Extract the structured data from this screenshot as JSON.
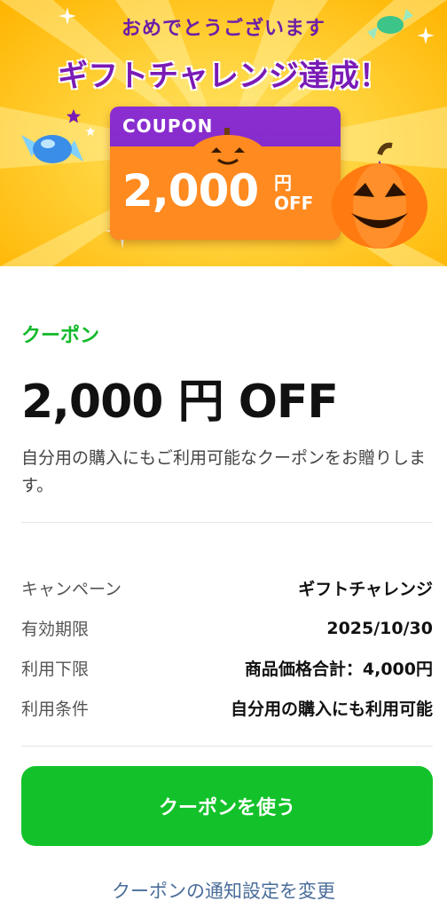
{
  "banner": {
    "subtitle": "おめでとうございます",
    "title": "ギフトチャレンジ達成！",
    "coupon_label": "COUPON",
    "coupon_amount": "2,000",
    "coupon_yen": "円",
    "coupon_off": "OFF",
    "icons": [
      "candy-icon",
      "pumpkin-icon",
      "star-icon",
      "sparkle-icon"
    ]
  },
  "coupon": {
    "kind_label": "クーポン",
    "amount": "2,000 円 OFF",
    "description": "自分用の購入にもご利用可能なクーポンをお贈りします。"
  },
  "details": [
    {
      "key": "キャンペーン",
      "value": "ギフトチャレンジ"
    },
    {
      "key": "有効期限",
      "value": "2025/10/30"
    },
    {
      "key": "利用下限",
      "value": "商品価格合計：4,000円"
    },
    {
      "key": "利用条件",
      "value": "自分用の購入にも利用可能"
    }
  ],
  "actions": {
    "use_button": "クーポンを使う",
    "notification_link": "クーポンの通知設定を変更"
  },
  "colors": {
    "accent_green": "#13c22a",
    "kind_green": "#12b92a",
    "banner_purple": "#7a1bb5",
    "link_blue": "#4a6d9a"
  }
}
